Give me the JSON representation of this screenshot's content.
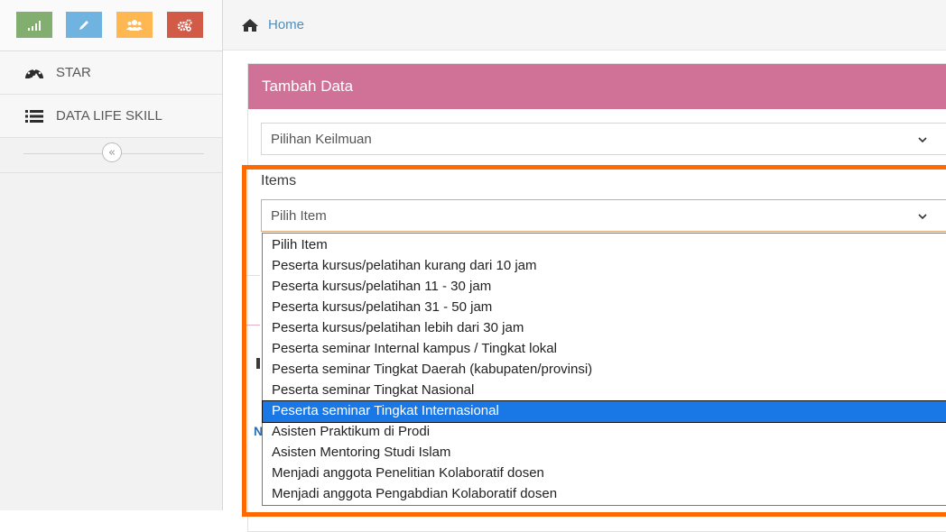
{
  "sidebar": {
    "shortcuts": [
      {
        "icon": "signal-icon",
        "color": "#82af6f"
      },
      {
        "icon": "pencil-icon",
        "color": "#6fb3e0"
      },
      {
        "icon": "users-icon",
        "color": "#ffb752"
      },
      {
        "icon": "cogs-icon",
        "color": "#d15b47"
      }
    ],
    "items": [
      {
        "label": "STAR",
        "icon": "tachometer-icon"
      },
      {
        "label": "DATA LIFE SKILL",
        "icon": "list-icon"
      }
    ],
    "collapse_glyph": "«"
  },
  "breadcrumb": {
    "home_label": "Home"
  },
  "panel": {
    "title": "Tambah Data",
    "keilmuan_placeholder": "Pilihan Keilmuan"
  },
  "items_field": {
    "label": "Items",
    "selected_value": "Pilih Item",
    "options": [
      "Pilih Item",
      "Peserta kursus/pelatihan kurang dari 10 jam",
      "Peserta kursus/pelatihan 11 - 30 jam",
      "Peserta kursus/pelatihan 31 - 50 jam",
      "Peserta kursus/pelatihan lebih dari 30 jam",
      "Peserta seminar Internal kampus / Tingkat lokal",
      "Peserta seminar Tingkat Daerah (kabupaten/provinsi)",
      "Peserta seminar Tingkat Nasional",
      "Peserta seminar Tingkat Internasional",
      "Asisten Praktikum di Prodi",
      "Asisten Mentoring Studi Islam",
      "Menjadi anggota Penelitian Kolaboratif dosen",
      "Menjadi anggota Pengabdian Kolaboratif dosen"
    ],
    "highlighted_index": 8
  },
  "behind": {
    "n_letter": "N"
  },
  "colors": {
    "highlight": "#ff6a00",
    "panel_header": "#d07197",
    "link": "#4c8fbd",
    "selected_option": "#1a78e6"
  }
}
